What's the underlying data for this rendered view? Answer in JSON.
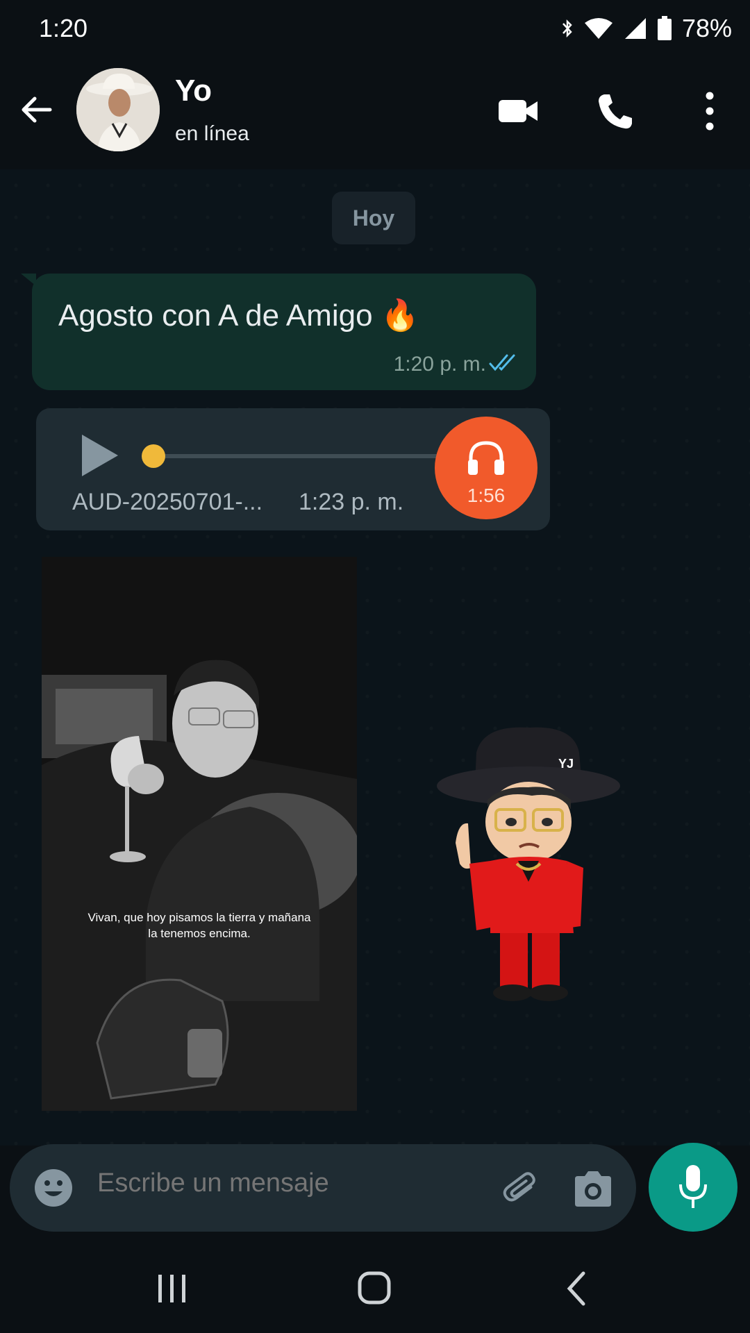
{
  "status": {
    "time": "1:20",
    "battery": "78%"
  },
  "header": {
    "contact_name": "Yo",
    "contact_status": "en línea"
  },
  "chat": {
    "day_chip": "Hoy",
    "messages": [
      {
        "text": "Agosto con A de Amigo 🔥",
        "time": "1:20 p. m."
      }
    ],
    "audio": {
      "file_name": "AUD-20250701-...",
      "time": "1:23 p. m.",
      "duration": "1:56",
      "progress": 0.0
    },
    "photo": {
      "caption": "Vivan, que hoy pisamos la tierra y mañana la tenemos encima."
    },
    "sticker": {
      "hat_text": "YJ"
    }
  },
  "composer": {
    "placeholder": "Escribe un mensaje"
  },
  "colors": {
    "accent": "#0a9a87",
    "outgoing_bubble": "#11302b",
    "audio_badge": "#f15a2b",
    "read_ticks": "#53bdeb"
  },
  "icons": [
    "back-arrow-icon",
    "video-call-icon",
    "phone-icon",
    "more-vertical-icon",
    "double-check-icon",
    "play-icon",
    "headphones-icon",
    "emoji-icon",
    "attach-icon",
    "camera-icon",
    "mic-icon",
    "recents-icon",
    "home-icon",
    "back-nav-icon"
  ]
}
